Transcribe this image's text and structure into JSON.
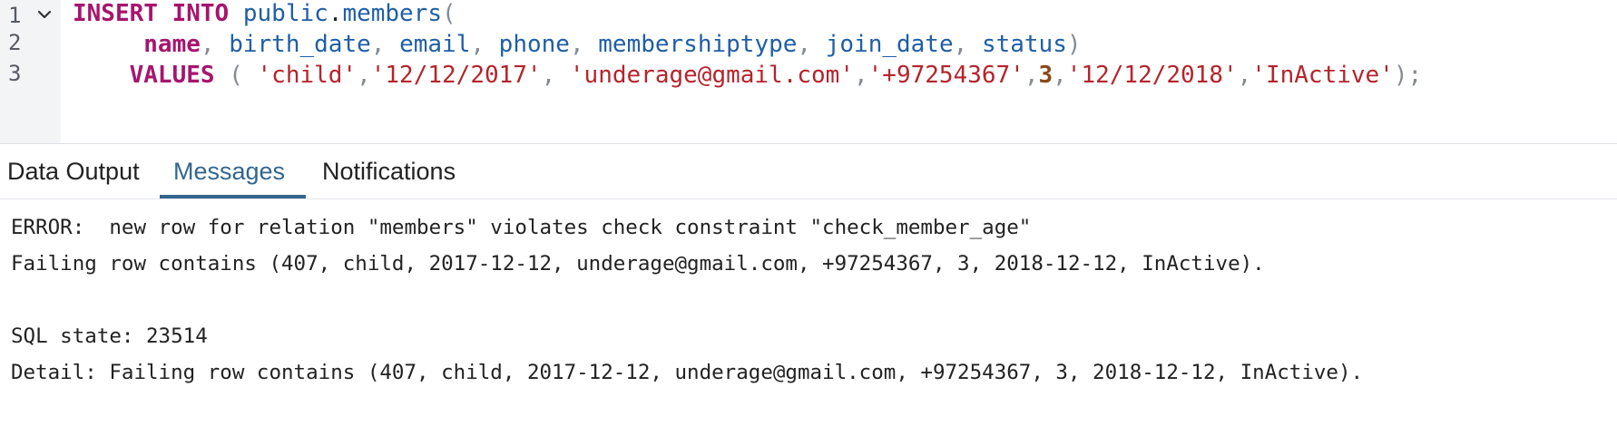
{
  "editor": {
    "line_numbers": [
      "1",
      "2",
      "3"
    ],
    "lines": [
      [
        {
          "t": "INSERT",
          "c": "kw"
        },
        {
          "t": " "
        },
        {
          "t": "INTO",
          "c": "kw"
        },
        {
          "t": " "
        },
        {
          "t": "public",
          "c": "id"
        },
        {
          "t": "."
        },
        {
          "t": "members",
          "c": "id"
        },
        {
          "t": "(",
          "c": "pn"
        }
      ],
      [
        {
          "t": "     "
        },
        {
          "t": "name",
          "c": "kw"
        },
        {
          "t": ", ",
          "c": "pn"
        },
        {
          "t": "birth_date",
          "c": "id"
        },
        {
          "t": ", ",
          "c": "pn"
        },
        {
          "t": "email",
          "c": "id"
        },
        {
          "t": ", ",
          "c": "pn"
        },
        {
          "t": "phone",
          "c": "id"
        },
        {
          "t": ", ",
          "c": "pn"
        },
        {
          "t": "membershiptype",
          "c": "id"
        },
        {
          "t": ", ",
          "c": "pn"
        },
        {
          "t": "join_date",
          "c": "id"
        },
        {
          "t": ", ",
          "c": "pn"
        },
        {
          "t": "status",
          "c": "id"
        },
        {
          "t": ")",
          "c": "pn"
        }
      ],
      [
        {
          "t": "    "
        },
        {
          "t": "VALUES",
          "c": "kw"
        },
        {
          "t": " ( ",
          "c": "pn"
        },
        {
          "t": "'child'",
          "c": "str"
        },
        {
          "t": ",",
          "c": "pn"
        },
        {
          "t": "'12/12/2017'",
          "c": "str"
        },
        {
          "t": ", ",
          "c": "pn"
        },
        {
          "t": "'underage@gmail.com'",
          "c": "str"
        },
        {
          "t": ",",
          "c": "pn"
        },
        {
          "t": "'+97254367'",
          "c": "str"
        },
        {
          "t": ",",
          "c": "pn"
        },
        {
          "t": "3",
          "c": "num"
        },
        {
          "t": ",",
          "c": "pn"
        },
        {
          "t": "'12/12/2018'",
          "c": "str"
        },
        {
          "t": ",",
          "c": "pn"
        },
        {
          "t": "'InActive'",
          "c": "str"
        },
        {
          "t": ");",
          "c": "pn"
        }
      ]
    ]
  },
  "tabs": {
    "data_output": "Data Output",
    "messages": "Messages",
    "notifications": "Notifications"
  },
  "messages": {
    "error_line": "ERROR:  new row for relation \"members\" violates check constraint \"check_member_age\"",
    "failing_row_line": "Failing row contains (407, child, 2017-12-12, underage@gmail.com, +97254367, 3, 2018-12-12, InActive).",
    "sql_state_line": "SQL state: 23514",
    "detail_line": "Detail: Failing row contains (407, child, 2017-12-12, underage@gmail.com, +97254367, 3, 2018-12-12, InActive)."
  },
  "colors": {
    "keyword": "#a6156e",
    "identifier": "#1f5ea8",
    "string": "#b5242c",
    "number": "#8a4a1a",
    "active_tab": "#326690"
  },
  "icons": {
    "fold": "chevron-down-icon"
  }
}
